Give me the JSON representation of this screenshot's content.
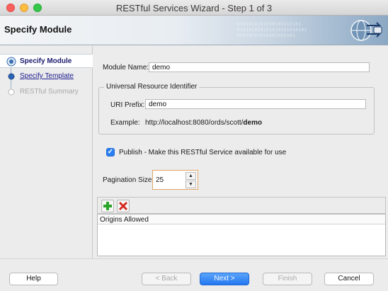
{
  "window": {
    "title": "RESTful Services Wizard - Step 1 of 3"
  },
  "banner": {
    "title": "Specify Module",
    "bits": [
      "0101010101010101010101",
      "010101010101010101010101",
      "01010101010101010101"
    ]
  },
  "nav": {
    "items": [
      {
        "label": "Specify Module",
        "state": "active"
      },
      {
        "label": "Specify Template",
        "state": "link"
      },
      {
        "label": "RESTful Summary",
        "state": "disabled"
      }
    ]
  },
  "form": {
    "module_name_label": "Module Name:",
    "module_name_value": "demo",
    "uri_group_title": "Universal Resource Identifier",
    "uri_prefix_label": "URI Prefix:",
    "uri_prefix_value": "demo",
    "example_label": "Example:",
    "example_prefix": "http://localhost:8080/ords/scott/",
    "example_bold": "demo",
    "publish_checked": true,
    "publish_label": "Publish - Make this RESTful Service available for use",
    "pagination_label": "Pagination Size:",
    "pagination_value": "25"
  },
  "origins": {
    "header": "Origins Allowed"
  },
  "footer": {
    "help": "Help",
    "back": "< Back",
    "next": "Next >",
    "finish": "Finish",
    "cancel": "Cancel"
  },
  "colors": {
    "accent": "#2477f0",
    "add_icon": "#2aa52a",
    "remove_icon": "#d42a1f"
  }
}
